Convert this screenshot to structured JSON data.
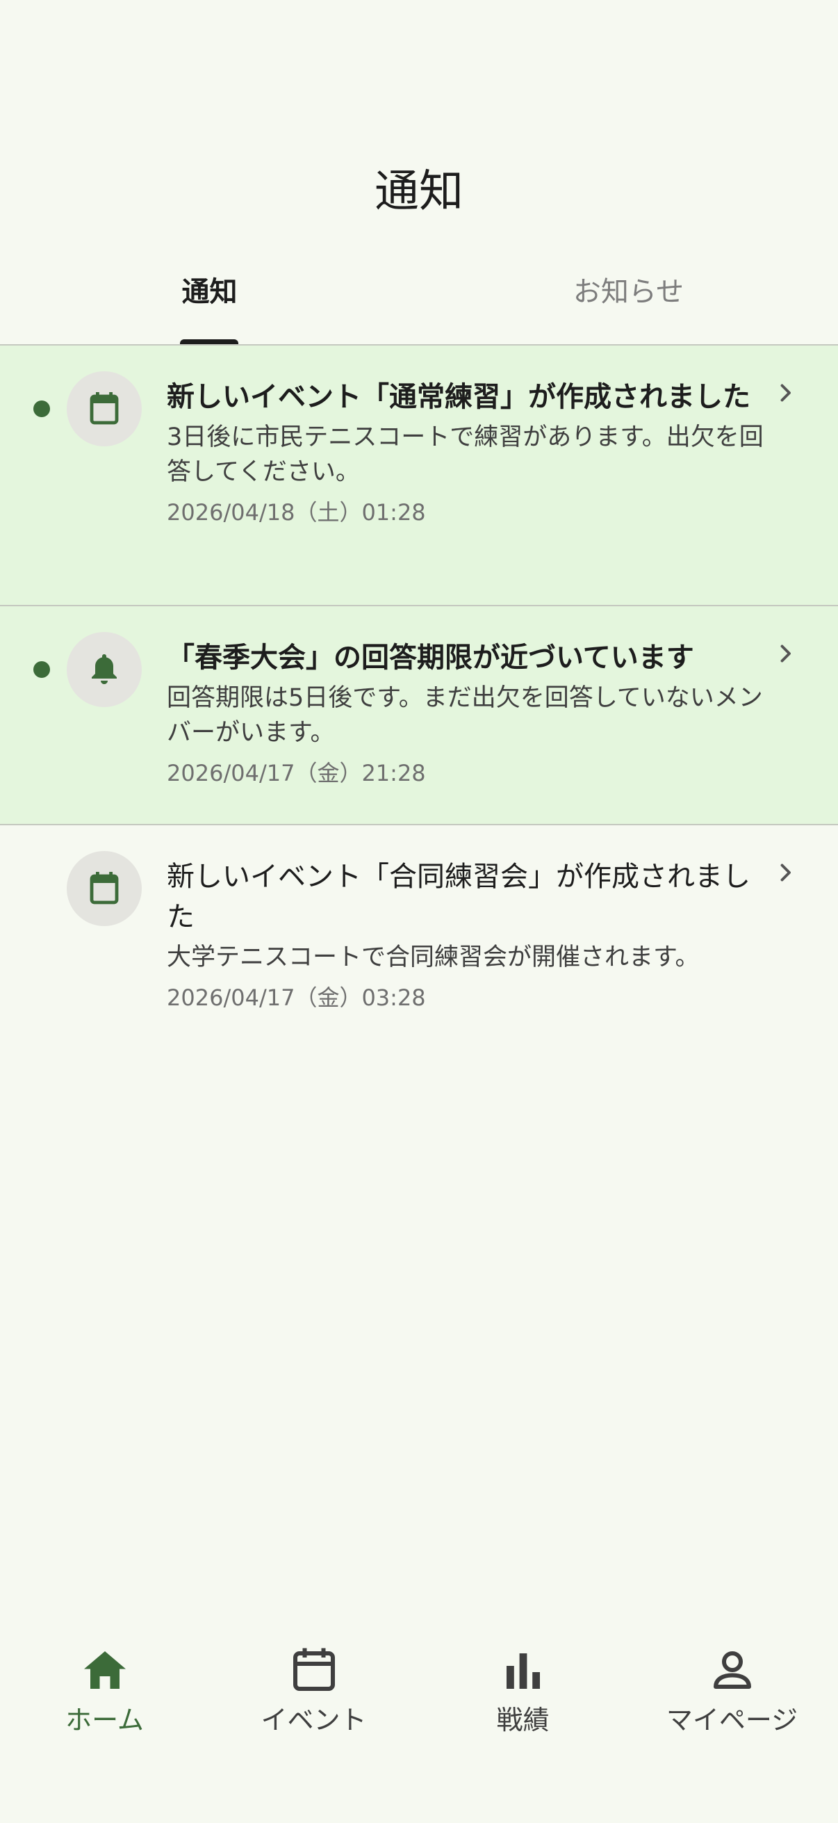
{
  "header": {
    "title": "通知"
  },
  "tabs": [
    {
      "label": "通知",
      "active": true
    },
    {
      "label": "お知らせ",
      "active": false
    }
  ],
  "notifications": [
    {
      "title": "新しいイベント「通常練習」が作成されました",
      "body": "3日後に市民テニスコートで練習があります。出欠を回答してください。",
      "date": "2026/04/18（土）01:28",
      "unread": true,
      "icon": "calendar-icon"
    },
    {
      "title": "「春季大会」の回答期限が近づいています",
      "body": "回答期限は5日後です。まだ出欠を回答していないメンバーがいます。",
      "date": "2026/04/17（金）21:28",
      "unread": true,
      "icon": "bell-icon"
    },
    {
      "title": "新しいイベント「合同練習会」が作成されました",
      "body": "大学テニスコートで合同練習会が開催されます。",
      "date": "2026/04/17（金）03:28",
      "unread": false,
      "icon": "calendar-icon"
    }
  ],
  "bottom_nav": [
    {
      "label": "ホーム",
      "icon": "home-icon",
      "active": true
    },
    {
      "label": "イベント",
      "icon": "calendar-icon",
      "active": false
    },
    {
      "label": "戦績",
      "icon": "bar-chart-icon",
      "active": false
    },
    {
      "label": "マイページ",
      "icon": "person-icon",
      "active": false
    }
  ],
  "colors": {
    "background": "#f6f9f1",
    "unread_background": "#e4f6dd",
    "accent": "#3c6b39",
    "divider": "#c4c8bf"
  }
}
